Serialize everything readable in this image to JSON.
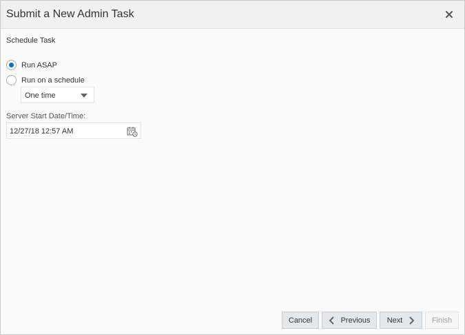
{
  "dialog": {
    "title": "Submit a New Admin Task",
    "close_icon": "close-icon"
  },
  "schedule": {
    "section_label": "Schedule Task",
    "options": [
      {
        "label": "Run ASAP",
        "selected": true
      },
      {
        "label": "Run on a schedule",
        "selected": false
      }
    ],
    "frequency": {
      "value": "One time"
    }
  },
  "start": {
    "label": "Server Start Date/Time:",
    "value": "12/27/18 12:57 AM",
    "icon": "calendar-icon"
  },
  "footer": {
    "cancel_label": "Cancel",
    "previous_label": "Previous",
    "next_label": "Next",
    "finish_label": "Finish",
    "finish_enabled": false
  },
  "colors": {
    "accent": "#0572ce",
    "header_bg": "#f1f1f1",
    "button_bg": "#e4e8ea"
  }
}
